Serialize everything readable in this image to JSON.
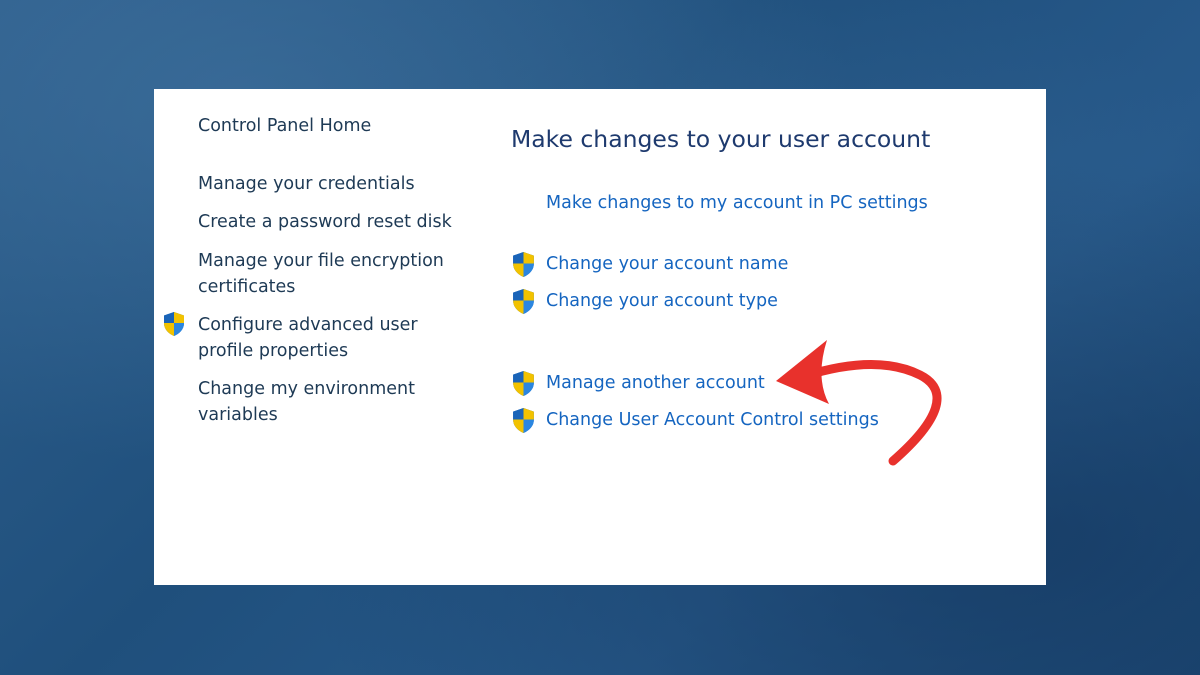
{
  "nav": {
    "home": "Control Panel Home",
    "items": [
      {
        "label": "Manage your credentials"
      },
      {
        "label": "Create a password reset disk"
      },
      {
        "label": "Manage your file encryption certificates"
      },
      {
        "label": "Configure advanced user profile properties",
        "shield": true
      },
      {
        "label": "Change my environment variables"
      }
    ]
  },
  "main": {
    "title": "Make changes to your user account",
    "pc_settings_link": "Make changes to my account in PC settings",
    "links": [
      {
        "label": "Change your account name",
        "shield": true
      },
      {
        "label": "Change your account type",
        "shield": true
      },
      {
        "label": "Manage another account",
        "shield": true
      },
      {
        "label": "Change User Account Control settings",
        "shield": true
      }
    ]
  },
  "colors": {
    "link": "#1565c0",
    "title": "#1e3a6e",
    "nav_text": "#1e3a55",
    "annotation_arrow": "#e8312c",
    "background": "#245584"
  },
  "icons": {
    "shield": "uac-shield-icon",
    "annotation": "curved-red-arrow"
  }
}
